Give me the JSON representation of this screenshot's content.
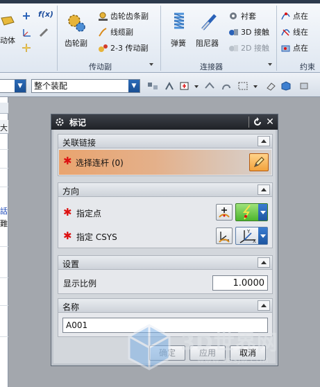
{
  "ribbon": {
    "items": {
      "fx": "f(x)",
      "motion": "动体",
      "gear": "齿轮副",
      "rack_pinion": "齿轮齿条副",
      "cable": "线缆副",
      "two_three": "2-3 传动副",
      "spring": "弹簧",
      "damper": "阻尼器",
      "bushing": "衬套",
      "contact3d": "3D 接触",
      "contact2d": "2D 接触",
      "pt_on_curve": "点在",
      "line_on": "线在",
      "pt_on2": "点在"
    },
    "groups": {
      "transmission": "传动副",
      "connectors": "连接器",
      "constraint": "约束"
    }
  },
  "toolbar": {
    "select_value": "整个装配"
  },
  "left_panel": {
    "fragments": [
      "大",
      "話",
      "難"
    ]
  },
  "dialog": {
    "title": "标记",
    "sections": {
      "link": {
        "title": "关联链接",
        "select_label": "选择连杆 (0)"
      },
      "direction": {
        "title": "方向",
        "point_label": "指定点",
        "csys_label": "指定 CSYS"
      },
      "settings": {
        "title": "设置",
        "scale_label": "显示比例",
        "scale_value": "1.0000"
      },
      "name": {
        "title": "名称",
        "value": "A001"
      }
    },
    "buttons": {
      "ok": "确定",
      "apply": "应用",
      "cancel": "取消"
    }
  },
  "watermark": {
    "text": "3D世界网",
    "url": "WWW.3DSJW.COM"
  },
  "colors": {
    "accent_orange": "#e9a46f",
    "title_bar": "#2b2e34",
    "required": "#dd1111"
  }
}
